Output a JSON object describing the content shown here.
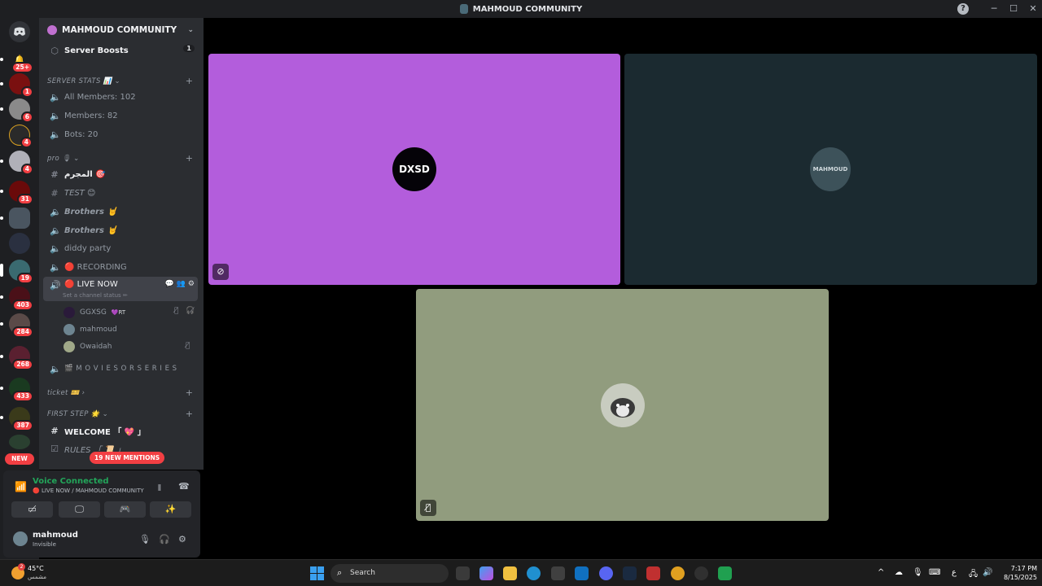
{
  "window": {
    "title": "MAHMOUD COMMUNITY",
    "help": "?",
    "minimize": "─",
    "maximize": "☐",
    "close": "✕"
  },
  "server_rail": {
    "badges": [
      "25+",
      "1",
      "6",
      "4",
      "4",
      "31",
      "19",
      "403",
      "284",
      "268",
      "433",
      "387"
    ],
    "new_label": "NEW"
  },
  "server": {
    "name": "MAHMOUD COMMUNITY",
    "boosts_label": "Server Boosts",
    "boosts_count": "1"
  },
  "categories": {
    "server_stats": "SERVER STATS 📊",
    "pro": "pro 🎙",
    "ticket": "ticket 🎫",
    "first_step": "FIRST STEP 🌟"
  },
  "channels": {
    "all_members": "All Members: 102",
    "members": "Members: 82",
    "bots": "Bots: 20",
    "almujrim": "المجرم 🎯",
    "test": "TEST 😊",
    "brothers1": "Brothers 🤘",
    "brothers2": "Brothers 🤘",
    "diddy": "diddy party",
    "recording": "🔴 RECORDING",
    "live_now": "🔴 LIVE NOW",
    "live_status": "Set a channel status ✏",
    "movies": "🎬 M O V I E S  O R  S E R I E S",
    "welcome": "WELCOME 「 💖 」",
    "rules": "RULES 「 📜 」"
  },
  "voice_members": [
    {
      "name": "GGXSG",
      "tag": "💜RT"
    },
    {
      "name": "mahmoud",
      "tag": ""
    },
    {
      "name": "Owaidah",
      "tag": ""
    }
  ],
  "new_mentions": "19 NEW MENTIONS",
  "voice": {
    "status": "Voice Connected",
    "location": "🔴 LIVE NOW / MAHMOUD COMMUNITY"
  },
  "user": {
    "name": "mahmoud",
    "status": "Invisible"
  },
  "tiles": {
    "dxsd_logo": "DXSD",
    "mahmoud_logo": "MAHMOUD"
  },
  "taskbar": {
    "temp": "45°C",
    "weather_desc": "مشمس",
    "weather_badge": "2",
    "search": "Search",
    "lang": "ع",
    "time": "7:17 PM",
    "date": "8/15/2025"
  },
  "colors": {
    "tile1": "#b35ddc",
    "tile2": "#1b2a30",
    "tile3": "#919c7e",
    "accent_green": "#23a55a",
    "badge_red": "#f23f43"
  }
}
